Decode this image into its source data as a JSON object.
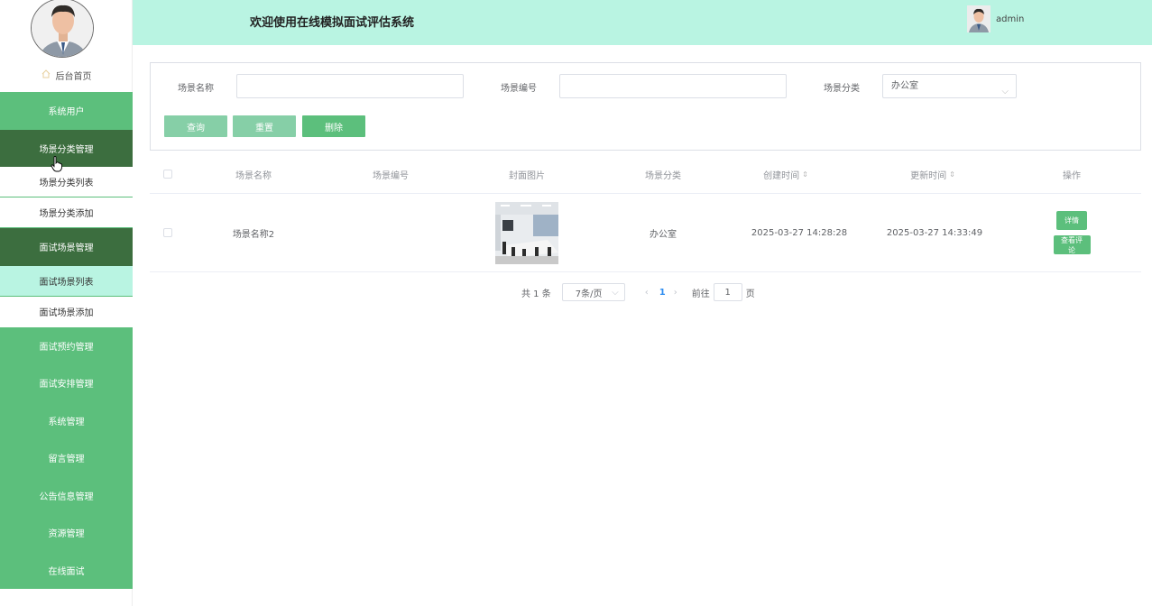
{
  "header": {
    "title": "欢迎使用在线模拟面试评估系统",
    "username": "admin"
  },
  "sidebar": {
    "home_label": "后台首页",
    "items": [
      {
        "label": "系统用户"
      },
      {
        "label": "场景分类管理",
        "expanded": true,
        "children": [
          "场景分类列表",
          "场景分类添加"
        ]
      },
      {
        "label": "面试场景管理",
        "expanded": true,
        "children": [
          "面试场景列表",
          "面试场景添加"
        ],
        "active_child": "面试场景列表"
      },
      {
        "label": "面试预约管理"
      },
      {
        "label": "面试安排管理"
      },
      {
        "label": "系统管理"
      },
      {
        "label": "留言管理"
      },
      {
        "label": "公告信息管理"
      },
      {
        "label": "资源管理"
      },
      {
        "label": "在线面试"
      }
    ]
  },
  "search": {
    "name_label": "场景名称",
    "name_value": "",
    "code_label": "场景编号",
    "code_value": "",
    "category_label": "场景分类",
    "category_value": "办公室",
    "query_button": "查询",
    "reset_button": "重置",
    "delete_button": "删除"
  },
  "table": {
    "columns": [
      "场景名称",
      "场景编号",
      "封面图片",
      "场景分类",
      "创建时间",
      "更新时间",
      "操作"
    ],
    "rows": [
      {
        "name": "场景名称2",
        "code": "",
        "category": "办公室",
        "created": "2025-03-27 14:28:28",
        "updated": "2025-03-27 14:33:49",
        "actions": [
          "详情",
          "查看评论"
        ]
      }
    ]
  },
  "pagination": {
    "total": "共 1 条",
    "page_size": "7条/页",
    "current_page": "1",
    "goto_prefix": "前往",
    "goto_value": "1",
    "goto_suffix": "页"
  },
  "colors": {
    "header_bg": "#b9f4e2",
    "menu_bg": "#5cbf7c",
    "menu_active_bg": "#3c6e3f",
    "primary_button": "#5cbf7c",
    "light_button": "#86cfa7"
  }
}
